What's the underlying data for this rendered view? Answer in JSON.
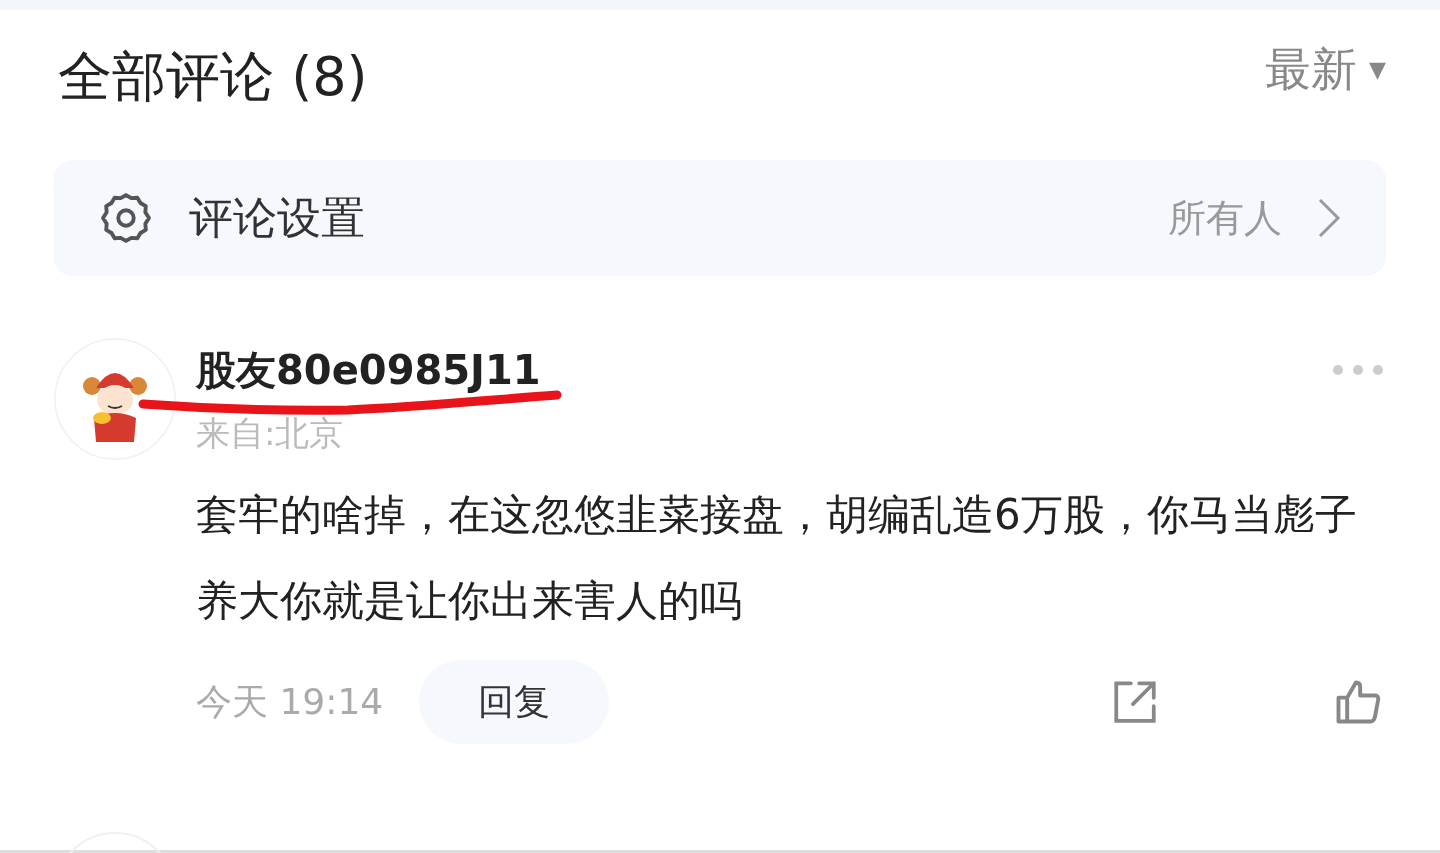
{
  "header": {
    "title": "全部评论 (8)",
    "sort": "最新",
    "sort_caret": "▼"
  },
  "settings": {
    "label": "评论设置",
    "value": "所有人"
  },
  "comments": [
    {
      "username": "股友80e0985J11",
      "location": "来自:北京",
      "text": "套牢的啥掉，在这忽悠韭菜接盘，胡编乱造6万股，你马当彪子养大你就是让你出来害人的吗",
      "time": "今天 19:14",
      "reply": "回复"
    }
  ]
}
